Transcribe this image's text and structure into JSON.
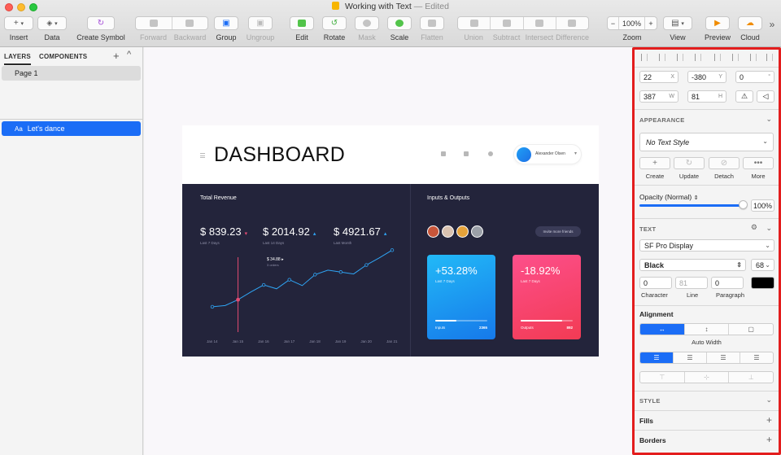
{
  "window": {
    "title": "Working with Text",
    "title_sep": " — ",
    "status": "Edited"
  },
  "toolbar": {
    "insert": "Insert",
    "data": "Data",
    "create_symbol": "Create Symbol",
    "forward": "Forward",
    "backward": "Backward",
    "group": "Group",
    "ungroup": "Ungroup",
    "edit": "Edit",
    "rotate": "Rotate",
    "mask": "Mask",
    "scale": "Scale",
    "flatten": "Flatten",
    "union": "Union",
    "subtract": "Subtract",
    "intersect": "Intersect",
    "difference": "Difference",
    "zoom_label": "Zoom",
    "zoom_value": "100%",
    "zoom_minus": "−",
    "zoom_plus": "+",
    "view": "View",
    "preview": "Preview",
    "cloud": "Cloud",
    "overflow": "»"
  },
  "layers_panel": {
    "tab_layers": "LAYERS",
    "tab_components": "COMPONENTS",
    "add": "+",
    "collapse": "^",
    "page": "Page 1",
    "layer_icon_text": "Aa",
    "layer_name": "Let's dance"
  },
  "artboard": {
    "title": "DASHBOARD",
    "user_name": "Alexander Olsen",
    "revenue_title": "Total Revenue",
    "io_title": "Inputs & Outputs",
    "revenue": [
      {
        "value": "$ 839.23",
        "period": "Last 7 Days"
      },
      {
        "value": "$ 2014.92",
        "period": "Last 14 Days"
      },
      {
        "value": "$ 4921.67",
        "period": "Last Month"
      }
    ],
    "tooltip_value": "$ 34.88",
    "tooltip_sub": "3 orders",
    "x_ticks": [
      "Jan 14",
      "Jan 15",
      "Jan 16",
      "Jan 17",
      "Jan 18",
      "Jan 19",
      "Jan 20",
      "Jan 21"
    ],
    "invite_label": "Invite more friends",
    "cards": [
      {
        "pct": "+53.28%",
        "period": "Last 7 Days",
        "label": "Inputs",
        "value": "2365",
        "progress": 0.4
      },
      {
        "pct": "-18.92%",
        "period": "Last 7 Days",
        "label": "Outputs",
        "value": "892",
        "progress": 0.8
      }
    ],
    "colors": {
      "dark_bg": "#23243b",
      "line": "#2fa5f5",
      "marker": "#e44b72",
      "card_blue": "#22b9f7",
      "card_red": "#fd4f8b"
    }
  },
  "chart_data": {
    "type": "line",
    "categories": [
      "Jan 14",
      "Jan 15",
      "Jan 16",
      "Jan 17",
      "Jan 18",
      "Jan 19",
      "Jan 20",
      "Jan 21"
    ],
    "x": [
      0,
      0.5,
      1,
      1.5,
      2,
      2.5,
      3,
      3.5,
      4,
      4.5,
      5,
      5.5,
      6,
      6.5,
      7
    ],
    "values": [
      14,
      16,
      25,
      37,
      48,
      42,
      56,
      47,
      64,
      71,
      68,
      65,
      79,
      90,
      102
    ],
    "ylim": [
      0,
      110
    ],
    "highlight_index": 2,
    "grid": false,
    "title": "",
    "xlabel": "",
    "ylabel": ""
  },
  "inspector": {
    "x": "22",
    "x_suffix": "X",
    "y": "-380",
    "y_suffix": "Y",
    "rotation": "0",
    "rotation_suffix": "°",
    "w": "387",
    "w_suffix": "W",
    "h": "81",
    "h_suffix": "H",
    "appearance": "APPEARANCE",
    "text_style": "No Text Style",
    "style_create": "Create",
    "style_update": "Update",
    "style_detach": "Detach",
    "style_more": "More",
    "opacity_label": "Opacity (Normal)",
    "opacity_value": "100%",
    "opacity": 1.0,
    "text_section": "TEXT",
    "font_family": "SF Pro Display",
    "font_weight": "Black",
    "font_size": "68",
    "character": "0",
    "line": "81",
    "paragraph": "0",
    "character_label": "Character",
    "line_label": "Line",
    "paragraph_label": "Paragraph",
    "text_color": "#000000",
    "alignment_label": "Alignment",
    "auto_width": "Auto Width",
    "style_section": "STYLE",
    "fills": "Fills",
    "borders": "Borders",
    "highlight_color": "#e31d1d"
  }
}
